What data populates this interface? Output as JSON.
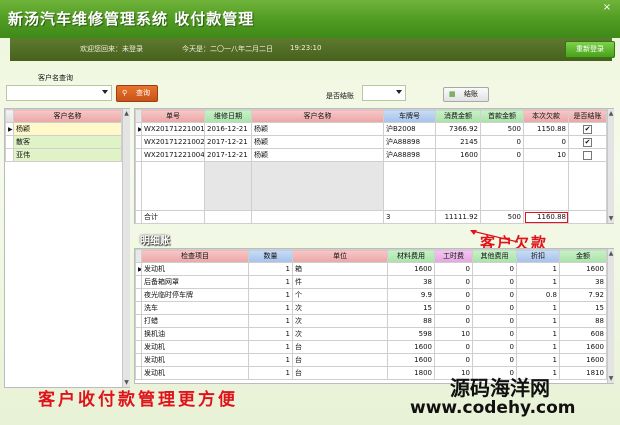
{
  "window": {
    "title": "新汤汽车维修管理系统  收付款管理",
    "close": "×"
  },
  "infobar": {
    "welcome": "欢迎您回来：未登录",
    "today_label": "今天是：二〇一八年二月二日",
    "time": "19:23:10",
    "relogin": "重新登录"
  },
  "search": {
    "label": "客户名查询",
    "query_button": "查询",
    "settled_label": "是否结账",
    "settle_button": "结账"
  },
  "customers": {
    "header": "客户名称",
    "items": [
      "杨颖",
      "散客",
      "亚伟"
    ]
  },
  "orders": {
    "columns": [
      "单号",
      "维修日期",
      "客户名称",
      "车牌号",
      "消费金额",
      "首款金额",
      "本次欠款",
      "是否结账"
    ],
    "rows": [
      {
        "id": "WX20171221001",
        "date": "2016-12-21",
        "customer": "杨颖",
        "plate": "沪B2008",
        "amount": "7366.92",
        "paid": "500",
        "debt": "1150.88",
        "settled": "✔"
      },
      {
        "id": "WX20171221002",
        "date": "2017-12-21",
        "customer": "杨颖",
        "plate": "沪A88898",
        "amount": "2145",
        "paid": "0",
        "debt": "0",
        "settled": "✔"
      },
      {
        "id": "WX20171221004",
        "date": "2017-12-21",
        "customer": "杨颖",
        "plate": "沪A88898",
        "amount": "1600",
        "paid": "0",
        "debt": "10",
        "settled": ""
      }
    ],
    "total": {
      "label": "合计",
      "count": "3",
      "amount": "11111.92",
      "paid": "500",
      "debt": "1160.88"
    }
  },
  "details": {
    "title": "明细账",
    "columns": [
      "检查项目",
      "数量",
      "单位",
      "材料费用",
      "工时费",
      "其他费用",
      "折扣",
      "金额"
    ],
    "rows": [
      [
        "发动机",
        "1",
        "箱",
        "1600",
        "0",
        "0",
        "1",
        "1600"
      ],
      [
        "后备箱网罩",
        "1",
        "件",
        "38",
        "0",
        "0",
        "1",
        "38"
      ],
      [
        "夜光临时停车牌",
        "1",
        "个",
        "9.9",
        "0",
        "0",
        "0.8",
        "7.92"
      ],
      [
        "洗车",
        "1",
        "次",
        "15",
        "0",
        "0",
        "1",
        "15"
      ],
      [
        "打蜡",
        "1",
        "次",
        "88",
        "0",
        "0",
        "1",
        "88"
      ],
      [
        "换机油",
        "1",
        "次",
        "598",
        "10",
        "0",
        "1",
        "608"
      ],
      [
        "发动机",
        "1",
        "台",
        "1600",
        "0",
        "0",
        "1",
        "1600"
      ],
      [
        "发动机",
        "1",
        "台",
        "1600",
        "0",
        "0",
        "1",
        "1600"
      ],
      [
        "发动机",
        "1",
        "台",
        "1800",
        "10",
        "0",
        "1",
        "1810"
      ]
    ]
  },
  "annotations": {
    "debt": "客户欠款",
    "bottom": "客户收付款管理更方便"
  },
  "watermark": {
    "line1": "源码海洋网",
    "line2": "www.codehy.com"
  },
  "colors": {
    "title_green": "#4f9a22",
    "info_dark": "#46611c",
    "query_orange": "#d85f20",
    "annotation_red": "#e0131a"
  }
}
